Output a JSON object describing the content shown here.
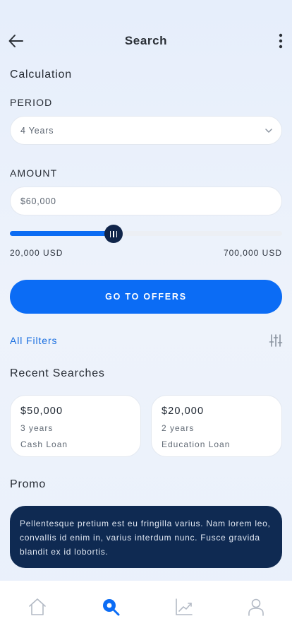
{
  "header": {
    "title": "Search",
    "back_icon": "arrow-left-icon",
    "menu_icon": "more-vertical-icon"
  },
  "calculation": {
    "title": "Calculation",
    "period_label": "PERIOD",
    "period_value": "4 Years",
    "amount_label": "AMOUNT",
    "amount_value": "$60,000",
    "slider_fraction": 0.38,
    "range_min": "20,000 USD",
    "range_max": "700,000 USD"
  },
  "cta_label": "GO TO OFFERS",
  "filters": {
    "label": "All Filters",
    "icon": "sliders-icon"
  },
  "recent": {
    "title": "Recent Searches",
    "items": [
      {
        "amount": "$50,000",
        "term": "3 years",
        "type": "Cash Loan"
      },
      {
        "amount": "$20,000",
        "term": "2 years",
        "type": "Education Loan"
      }
    ]
  },
  "promo": {
    "title": "Promo",
    "text": "Pellentesque pretium est eu fringilla varius. Nam lorem leo, convallis id enim in, varius interdum nunc. Fusce gravida blandit ex id lobortis."
  },
  "tabbar": {
    "items": [
      "home-icon",
      "search-icon",
      "chart-icon",
      "profile-icon"
    ],
    "active": "search-icon"
  },
  "colors": {
    "accent": "#0b6cf5",
    "dark": "#0f2a52",
    "link": "#1a6fe0"
  }
}
